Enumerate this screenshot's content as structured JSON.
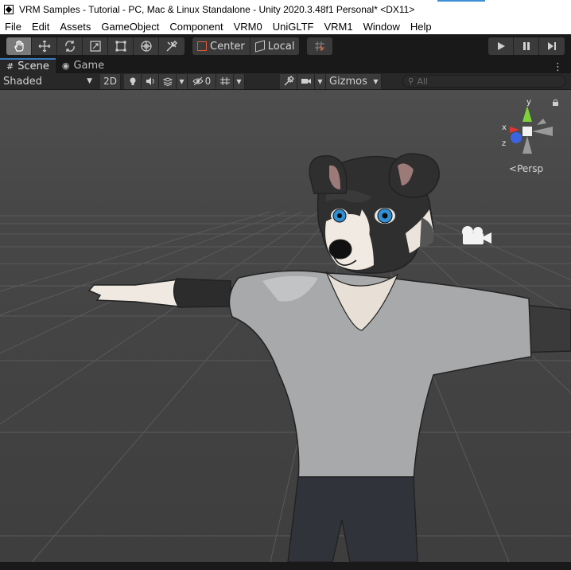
{
  "window": {
    "title": "VRM Samples - Tutorial - PC, Mac & Linux Standalone - Unity 2020.3.48f1 Personal* <DX11>"
  },
  "menu": [
    "File",
    "Edit",
    "Assets",
    "GameObject",
    "Component",
    "VRM0",
    "UniGLTF",
    "VRM1",
    "Window",
    "Help"
  ],
  "toolbar": {
    "tools": [
      "hand-tool",
      "move-tool",
      "rotate-tool",
      "scale-tool",
      "rect-tool",
      "transform-tool",
      "custom-tool"
    ],
    "active_tool": "hand-tool",
    "pivot_label": "Center",
    "space_label": "Local",
    "snap_icon": "grid-snap-icon",
    "play_icons": [
      "play-icon",
      "pause-icon",
      "step-icon"
    ]
  },
  "tabs": [
    {
      "label": "Scene",
      "icon": "scene-icon",
      "active": true
    },
    {
      "label": "Game",
      "icon": "game-icon",
      "active": false
    }
  ],
  "scene_toolbar": {
    "draw_mode": "Shaded",
    "mode_2d": "2D",
    "hidden_count": "0",
    "gizmos_label": "Gizmos",
    "search_placeholder": "All"
  },
  "viewport": {
    "projection_label": "Persp",
    "axes": {
      "x": "x",
      "y": "y",
      "z": "z"
    },
    "colors": {
      "background": "#444444",
      "grid": "#5a5a5a",
      "x_axis": "#e03434",
      "y_axis": "#7fd13b",
      "z_axis": "#3b63e0"
    }
  }
}
